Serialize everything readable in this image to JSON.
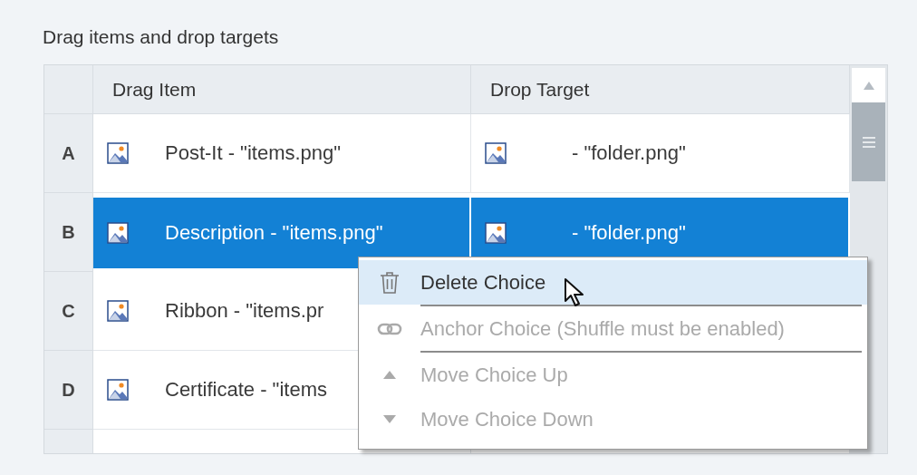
{
  "title": "Drag items and drop targets",
  "table": {
    "columns": [
      "Drag Item",
      "Drop Target"
    ],
    "rows": [
      {
        "label": "A",
        "drag_item": "Post-It - \"items.png\"",
        "drop_target": "- \"folder.png\"",
        "selected": false
      },
      {
        "label": "B",
        "drag_item": "Description - \"items.png\"",
        "drop_target": "- \"folder.png\"",
        "selected": true
      },
      {
        "label": "C",
        "drag_item": "Ribbon - \"items.pr",
        "selected": false
      },
      {
        "label": "D",
        "drag_item": "Certificate - \"items",
        "selected": false
      }
    ]
  },
  "context_menu": {
    "items": [
      {
        "kind": "delete",
        "label": "Delete Choice",
        "disabled": false,
        "highlighted": true
      },
      {
        "kind": "separator"
      },
      {
        "kind": "anchor",
        "label": "Anchor Choice (Shuffle must be enabled)",
        "disabled": true,
        "highlighted": false
      },
      {
        "kind": "separator"
      },
      {
        "kind": "move-up",
        "label": "Move Choice Up",
        "disabled": true,
        "highlighted": false
      },
      {
        "kind": "move-down",
        "label": "Move Choice Down",
        "disabled": true,
        "highlighted": false
      }
    ]
  }
}
